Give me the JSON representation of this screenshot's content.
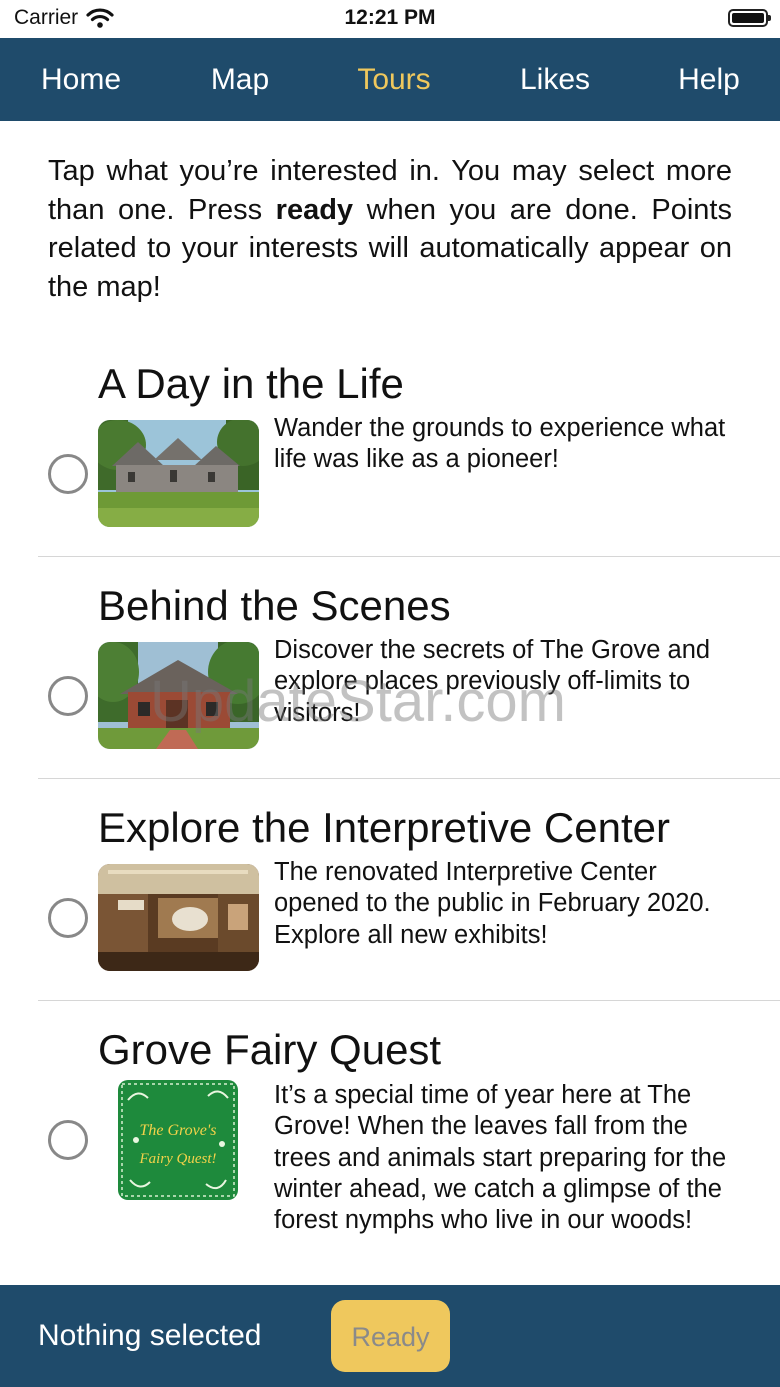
{
  "status": {
    "carrier": "Carrier",
    "time": "12:21 PM"
  },
  "nav": {
    "items": [
      "Home",
      "Map",
      "Tours",
      "Likes",
      "Help"
    ],
    "active": "Tours"
  },
  "intro": {
    "before": "Tap what you’re interested in. You may select more than one. Press ",
    "bold": "ready",
    "after": " when you are done. Points related to your interests will automatically appear on the map!"
  },
  "tours": [
    {
      "title": "A Day in the Life",
      "description": "Wander the grounds to experience what life was like as a pioneer!",
      "image": "pioneer-house-photo"
    },
    {
      "title": "Behind the Scenes",
      "description": "Discover the secrets of The Grove and explore places previously off-limits to visitors!",
      "image": "brick-building-photo"
    },
    {
      "title": "Explore the Interpretive Center",
      "description": "The renovated Interpretive Center opened to the public in February 2020. Explore all new exhibits!",
      "image": "museum-interior-photo"
    },
    {
      "title": "Grove Fairy Quest",
      "description": "It’s a special time of year here at The Grove! When the leaves fall from the trees and animals start preparing for the winter ahead, we catch a glimpse of the forest nymphs who live in our woods!",
      "image": "fairy-quest-poster",
      "poster_line1": "The Grove's",
      "poster_line2": "Fairy Quest!"
    }
  ],
  "watermark": "UpdateStar.com",
  "bottom": {
    "status": "Nothing selected",
    "ready_label": "Ready"
  },
  "colors": {
    "nav_bg": "#1f4b6b",
    "accent": "#efc85d",
    "poster_green": "#1e8a3c"
  }
}
